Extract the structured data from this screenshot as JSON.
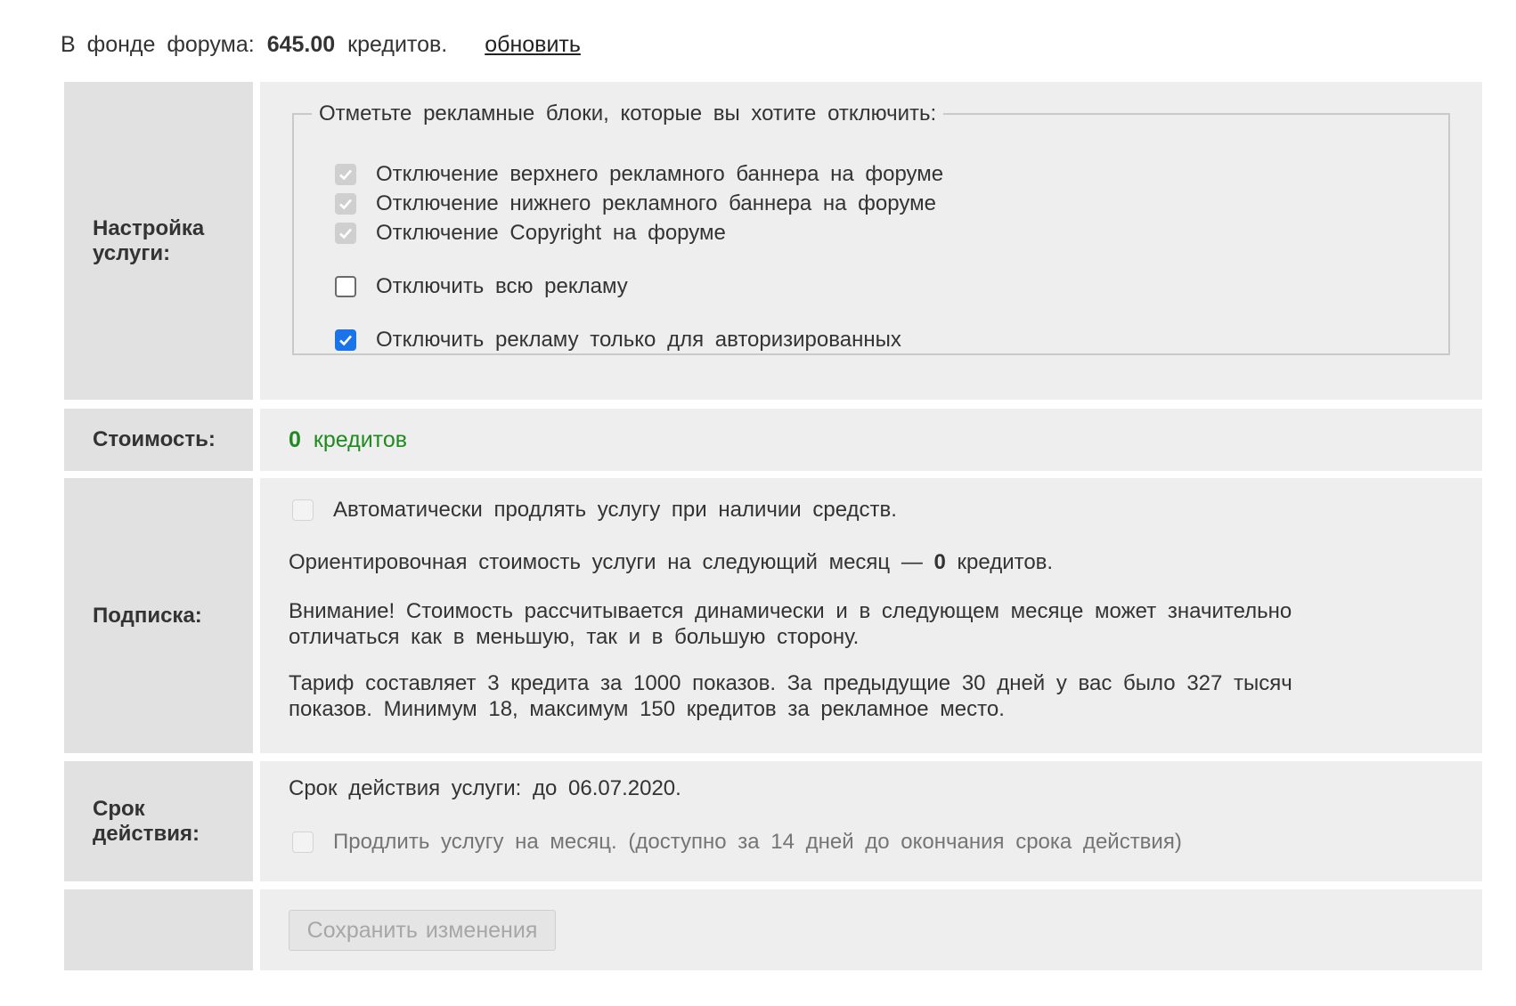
{
  "top": {
    "prefix": "В фонде форума:",
    "amount": "645.00",
    "suffix": "кредитов.",
    "refresh_link": "обновить"
  },
  "settings": {
    "label": "Настройка услуги:",
    "legend": "Отметьте рекламные блоки, которые вы хотите отключить:",
    "options": [
      {
        "label": "Отключение верхнего рекламного баннера на форуме",
        "state": "disabled-checked"
      },
      {
        "label": "Отключение нижнего рекламного баннера на форуме",
        "state": "disabled-checked"
      },
      {
        "label": "Отключение Copyright на форуме",
        "state": "disabled-checked"
      },
      {
        "label": "Отключить всю рекламу",
        "state": "unchecked"
      },
      {
        "label": "Отключить рекламу только для авторизированных",
        "state": "checked"
      }
    ]
  },
  "cost": {
    "label": "Стоимость:",
    "value": "0",
    "unit": "кредитов"
  },
  "subscription": {
    "label": "Подписка:",
    "auto_renew": "Автоматически продлять услугу при наличии средств.",
    "estimate_prefix": "Ориентировочная стоимость услуги на следующий месяц —",
    "estimate_value": "0",
    "estimate_suffix": "кредитов.",
    "warning": "Внимание! Стоимость рассчитывается динамически и в следующем месяце может значительно отличаться как в меньшую, так и в большую сторону.",
    "tariff": "Тариф составляет 3 кредита за 1000 показов. За предыдущие 30 дней у вас было 327 тысяч показов. Минимум 18, максимум 150 кредитов за рекламное место."
  },
  "term": {
    "label": "Срок действия:",
    "expiry": "Срок действия услуги: до 06.07.2020.",
    "extend": "Продлить услугу на месяц. (доступно за 14 дней до окончания срока действия)"
  },
  "save_button": "Сохранить изменения",
  "colors": {
    "label_bg": "#e1e1e1",
    "content_bg": "#eeeeee",
    "cost_green": "#1f8a1f",
    "checkbox_blue": "#1a73e8"
  }
}
